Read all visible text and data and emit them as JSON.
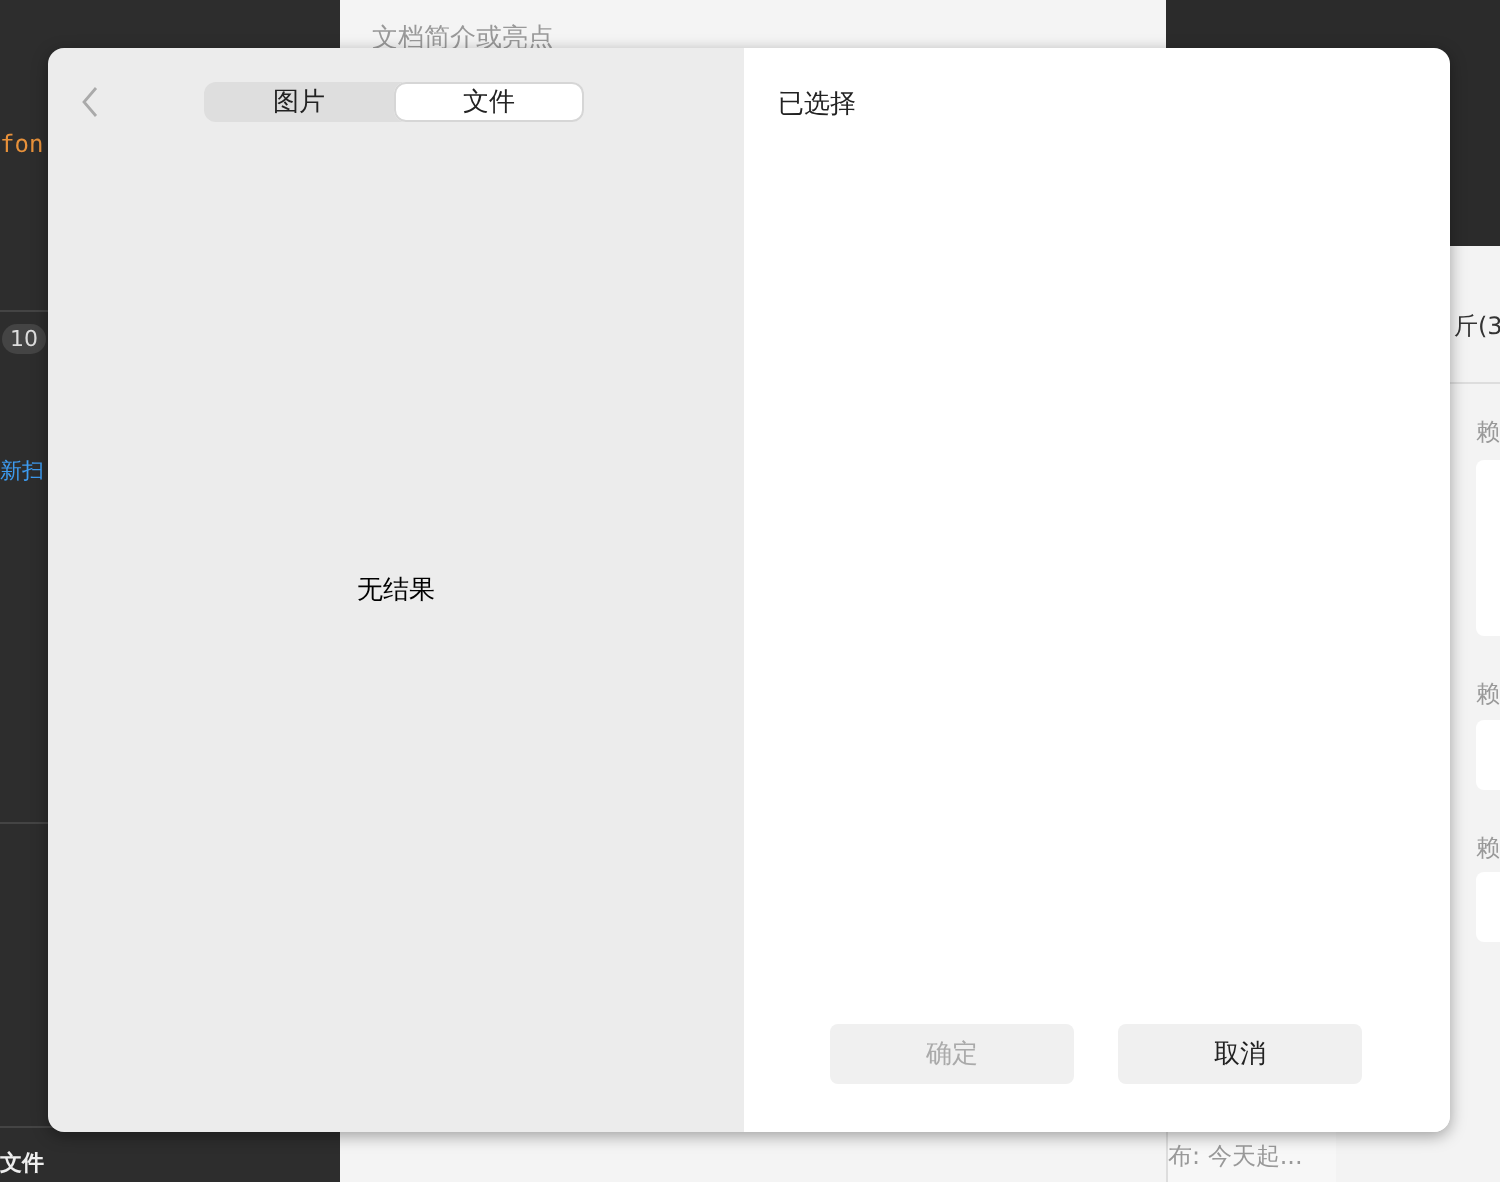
{
  "background": {
    "left": {
      "code_text": "fon",
      "badge": "10",
      "link": "新扫",
      "footer": "文件"
    },
    "center": {
      "subtitle": "文档简介或亮点"
    },
    "right": {
      "heading": "斤(3",
      "labels": [
        "赖",
        "赖",
        "赖"
      ],
      "status": "布: 今天起..."
    }
  },
  "dialog": {
    "tabs": [
      {
        "label": "图片",
        "selected": false
      },
      {
        "label": "文件",
        "selected": true
      }
    ],
    "empty_text": "无结果",
    "selected_heading": "已选择",
    "buttons": [
      {
        "label": "确定",
        "disabled": true
      },
      {
        "label": "取消",
        "disabled": false
      }
    ]
  }
}
